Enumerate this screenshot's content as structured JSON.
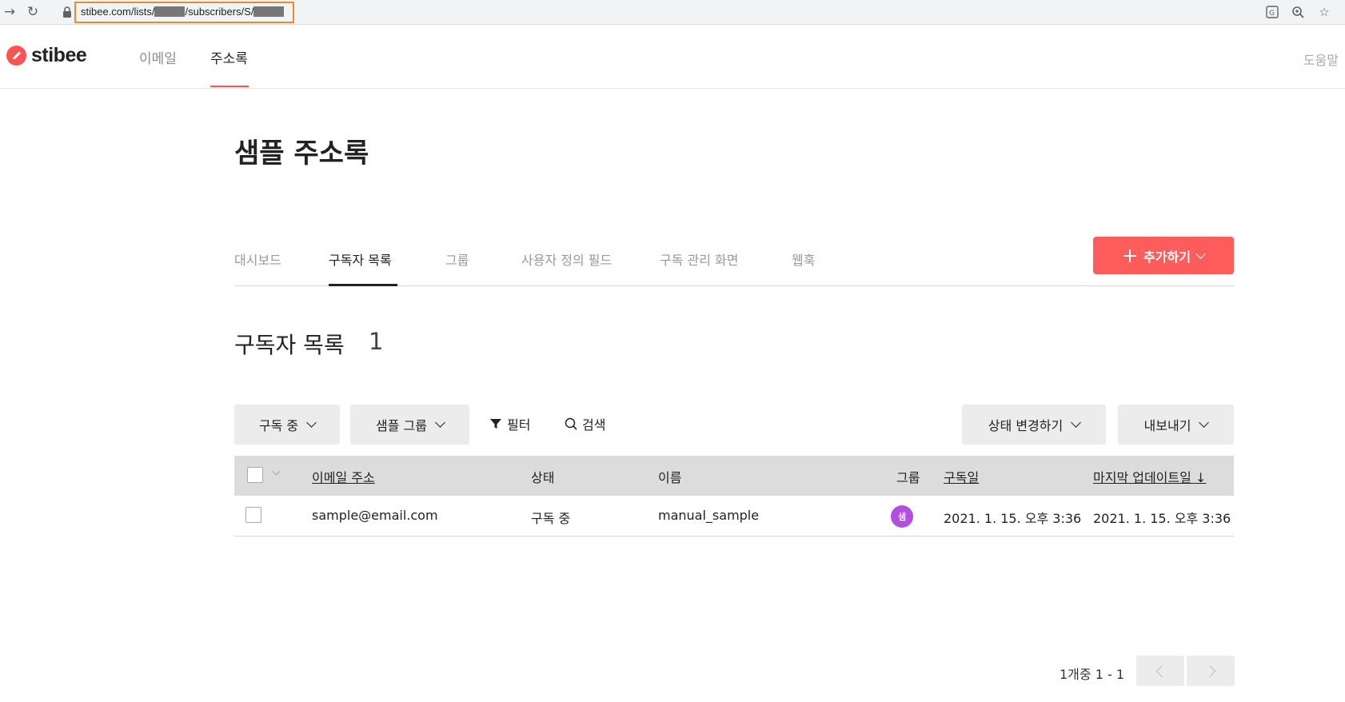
{
  "browser": {
    "url_part1": "stibee.com/lists/",
    "url_part2": "/subscribers/S/",
    "back_icon": "arrow-right-icon",
    "reload_icon": "reload-icon"
  },
  "topnav": {
    "logo": "stibee",
    "items": [
      "이메일",
      "주소록"
    ],
    "active": "주소록",
    "help": "도움말"
  },
  "page": {
    "title": "샘플 주소록"
  },
  "tabs": {
    "items": [
      "대시보드",
      "구독자 목록",
      "그룹",
      "사용자 정의 필드",
      "구독 관리 화면",
      "웹훅"
    ],
    "active": "구독자 목록",
    "add_button": "추가하기"
  },
  "subscribers": {
    "title": "구독자 목록",
    "count": "1",
    "filters": {
      "status": "구독 중",
      "group": "샘플 그룹",
      "filter": "필터",
      "search": "검색",
      "change_status": "상태 변경하기",
      "export": "내보내기"
    },
    "columns": {
      "email": "이메일 주소",
      "status": "상태",
      "name": "이름",
      "group": "그룹",
      "subscribed": "구독일",
      "updated": "마지막 업데이트일 ↓"
    },
    "rows": [
      {
        "email": "sample@email.com",
        "status": "구독 중",
        "name": "manual_sample",
        "group_badge": "샘",
        "subscribed": "2021. 1. 15. 오후 3:36",
        "updated": "2021. 1. 15. 오후 3:36"
      }
    ],
    "pagination": {
      "info": "1개중 1 - 1"
    }
  },
  "colors": {
    "accent": "#ff5c5c",
    "badge": "#b04ee0",
    "highlight": "#e98a2b"
  }
}
